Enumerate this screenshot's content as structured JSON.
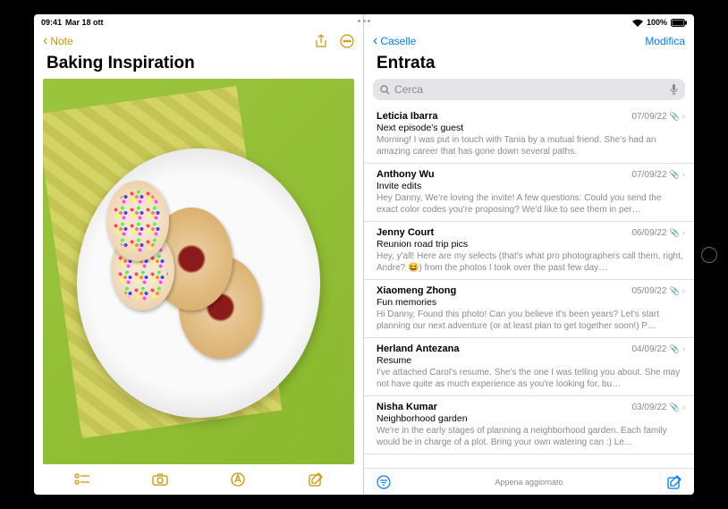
{
  "status": {
    "time": "09:41",
    "date": "Mar 18 ott",
    "battery": "100%"
  },
  "notes": {
    "back": "Note",
    "title": "Baking Inspiration"
  },
  "mail": {
    "back": "Caselle",
    "edit": "Modifica",
    "title": "Entrata",
    "search_ph": "Cerca",
    "footer": "Appena aggiornato",
    "items": [
      {
        "sender": "Leticia Ibarra",
        "date": "07/09/22",
        "subject": "Next episode's guest",
        "preview": "Morning! I was put in touch with Tania by a mutual friend. She's had an amazing career that has gone down several paths."
      },
      {
        "sender": "Anthony Wu",
        "date": "07/09/22",
        "subject": "Invite edits",
        "preview": "Hey Danny, We're loving the invite! A few questions: Could you send the exact color codes you're proposing? We'd like to see them in per…"
      },
      {
        "sender": "Jenny Court",
        "date": "06/09/22",
        "subject": "Reunion road trip pics",
        "preview": "Hey, y'all! Here are my selects (that's what pro photographers call them, right, Andre? 😆) from the photos I took over the past few day…"
      },
      {
        "sender": "Xiaomeng Zhong",
        "date": "05/09/22",
        "subject": "Fun memories",
        "preview": "Hi Danny, Found this photo! Can you believe it's been years? Let's start planning our next adventure (or at least plan to get together soon!) P…"
      },
      {
        "sender": "Herland Antezana",
        "date": "04/09/22",
        "subject": "Resume",
        "preview": "I've attached Carol's resume. She's the one I was telling you about. She may not have quite as much experience as you're looking for, bu…"
      },
      {
        "sender": "Nisha Kumar",
        "date": "03/09/22",
        "subject": "Neighborhood garden",
        "preview": "We're in the early stages of planning a neighborhood garden. Each family would be in charge of a plot. Bring your own watering can :) Le…"
      }
    ]
  }
}
